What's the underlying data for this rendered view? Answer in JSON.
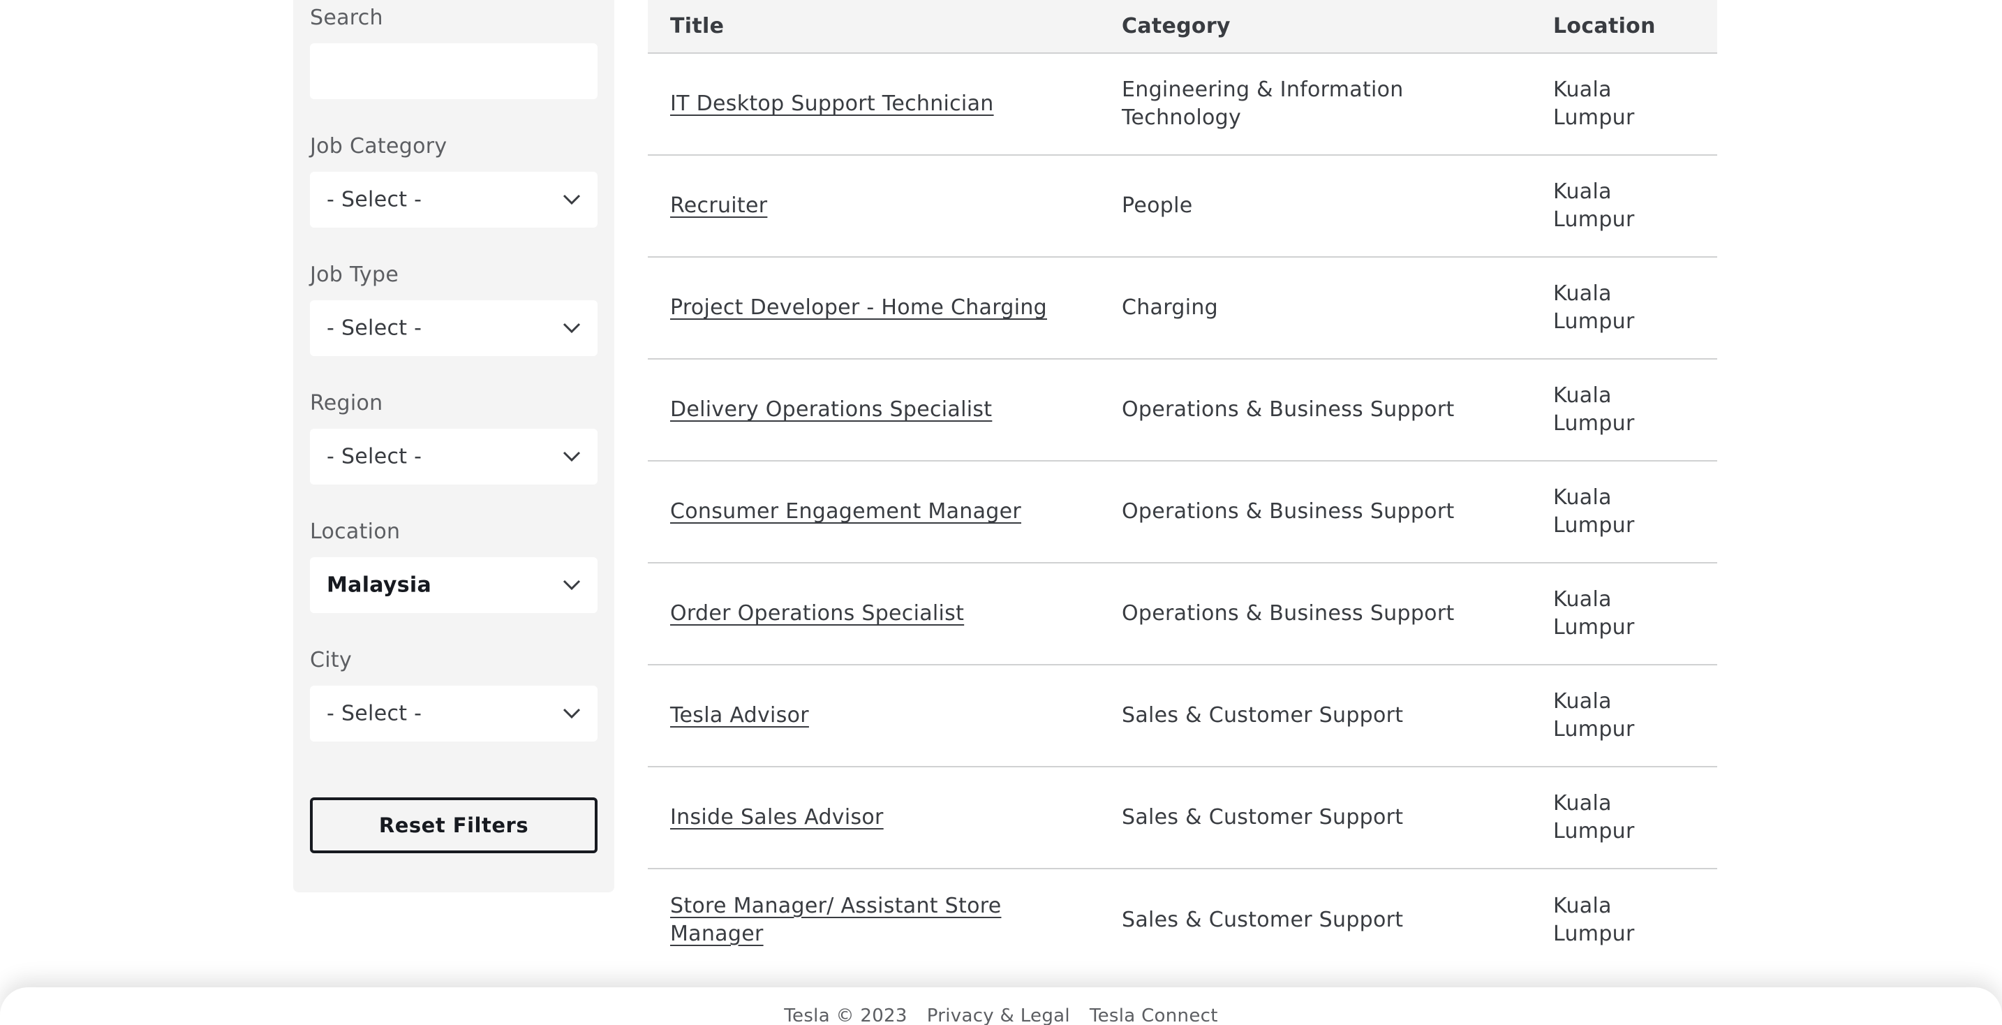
{
  "filters": {
    "search": {
      "label": "Search",
      "value": "",
      "placeholder": ""
    },
    "job_category": {
      "label": "Job Category",
      "value": "- Select -"
    },
    "job_type": {
      "label": "Job Type",
      "value": "- Select -"
    },
    "region": {
      "label": "Region",
      "value": "- Select -"
    },
    "location": {
      "label": "Location",
      "value": "Malaysia"
    },
    "city": {
      "label": "City",
      "value": "- Select -"
    },
    "reset_label": "Reset Filters"
  },
  "table": {
    "headers": {
      "title": "Title",
      "category": "Category",
      "location": "Location"
    },
    "rows": [
      {
        "title": "IT Desktop Support Technician",
        "category": "Engineering & Information Technology",
        "location": "Kuala Lumpur"
      },
      {
        "title": "Recruiter",
        "category": "People",
        "location": "Kuala Lumpur"
      },
      {
        "title": "Project Developer - Home Charging",
        "category": "Charging",
        "location": "Kuala Lumpur"
      },
      {
        "title": "Delivery Operations Specialist",
        "category": "Operations & Business Support",
        "location": "Kuala Lumpur"
      },
      {
        "title": "Consumer Engagement Manager",
        "category": "Operations & Business Support",
        "location": "Kuala Lumpur"
      },
      {
        "title": "Order Operations Specialist",
        "category": "Operations & Business Support",
        "location": "Kuala Lumpur"
      },
      {
        "title": "Tesla Advisor",
        "category": "Sales & Customer Support",
        "location": "Kuala Lumpur"
      },
      {
        "title": "Inside Sales Advisor",
        "category": "Sales & Customer Support",
        "location": "Kuala Lumpur"
      },
      {
        "title": "Store Manager/ Assistant Store Manager",
        "category": "Sales & Customer Support",
        "location": "Kuala Lumpur"
      }
    ]
  },
  "footer": {
    "copyright": "Tesla © 2023",
    "privacy_label": "Privacy & Legal",
    "connect_label": "Tesla Connect"
  },
  "icons": {
    "dropdown": "chevron-down-icon"
  },
  "colors": {
    "text": "#393c41",
    "heading": "#171a20",
    "panel": "#f4f4f4",
    "divider": "#d0d1d2"
  }
}
